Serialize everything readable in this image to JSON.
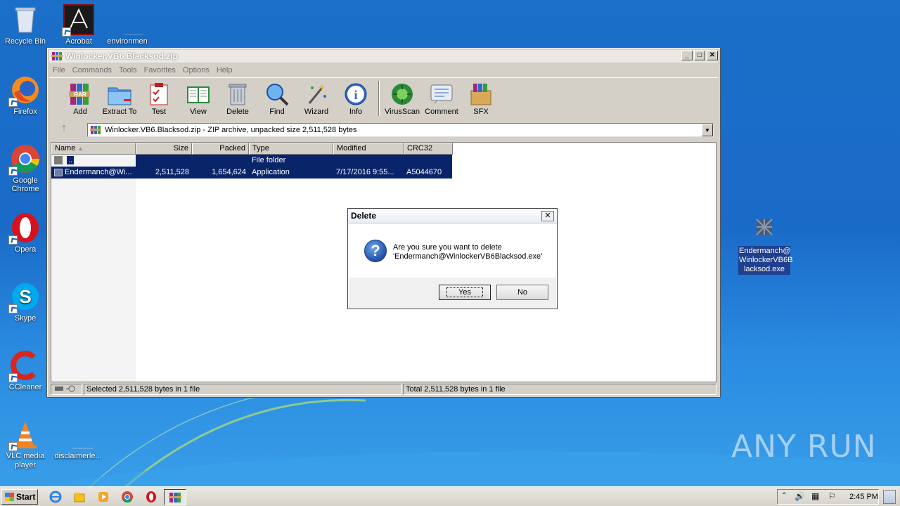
{
  "desktop": {
    "icons": [
      {
        "label": "Recycle Bin"
      },
      {
        "label": "Acrobat"
      },
      {
        "label": "environmen"
      },
      {
        "label": "Firefox"
      },
      {
        "label": "Google Chrome"
      },
      {
        "label": "Opera"
      },
      {
        "label": "Skype"
      },
      {
        "label": "CCleaner"
      },
      {
        "label": "VLC media player"
      },
      {
        "label": "disclaimerle..."
      }
    ],
    "selected_file": {
      "label": "Endermanch@WinlockerVB6Blacksod.exe",
      "lines": [
        "Endermanch@",
        "WinlockerVB6B",
        "lacksod.exe"
      ]
    }
  },
  "window": {
    "title": "Winlocker.VB6.Blacksod.zip",
    "menu": [
      "File",
      "Commands",
      "Tools",
      "Favorites",
      "Options",
      "Help"
    ],
    "toolbar": [
      {
        "label": "Add",
        "icon": "add-archive-icon"
      },
      {
        "label": "Extract To",
        "icon": "extract-folder-icon"
      },
      {
        "label": "Test",
        "icon": "test-clipboard-icon"
      },
      {
        "label": "View",
        "icon": "view-book-icon"
      },
      {
        "label": "Delete",
        "icon": "trash-icon"
      },
      {
        "label": "Find",
        "icon": "magnifier-icon"
      },
      {
        "label": "Wizard",
        "icon": "wand-icon"
      },
      {
        "label": "Info",
        "icon": "info-icon"
      },
      {
        "label": "VirusScan",
        "icon": "virus-icon"
      },
      {
        "label": "Comment",
        "icon": "comment-icon"
      },
      {
        "label": "SFX",
        "icon": "sfx-box-icon"
      }
    ],
    "address": "Winlocker.VB6.Blacksod.zip - ZIP archive, unpacked size 2,511,528 bytes",
    "columns": [
      "Name",
      "Size",
      "Packed",
      "Type",
      "Modified",
      "CRC32"
    ],
    "rows": [
      {
        "name": "..",
        "size": "",
        "packed": "",
        "type": "File folder",
        "modified": "",
        "crc": ""
      },
      {
        "name": "Endermanch@Wi...",
        "size": "2,511,528",
        "packed": "1,654,624",
        "type": "Application",
        "modified": "7/17/2016 9:55...",
        "crc": "A5044670"
      }
    ],
    "status_left": "Selected 2,511,528 bytes in 1 file",
    "status_right": "Total 2,511,528 bytes in 1 file"
  },
  "dialog": {
    "title": "Delete",
    "line1": "Are you sure you want to delete",
    "line2": "'Endermanch@WinlockerVB6Blacksod.exe'",
    "yes": "Yes",
    "no": "No"
  },
  "taskbar": {
    "start": "Start",
    "clock": "2:45 PM"
  },
  "watermark": "ANY RUN"
}
